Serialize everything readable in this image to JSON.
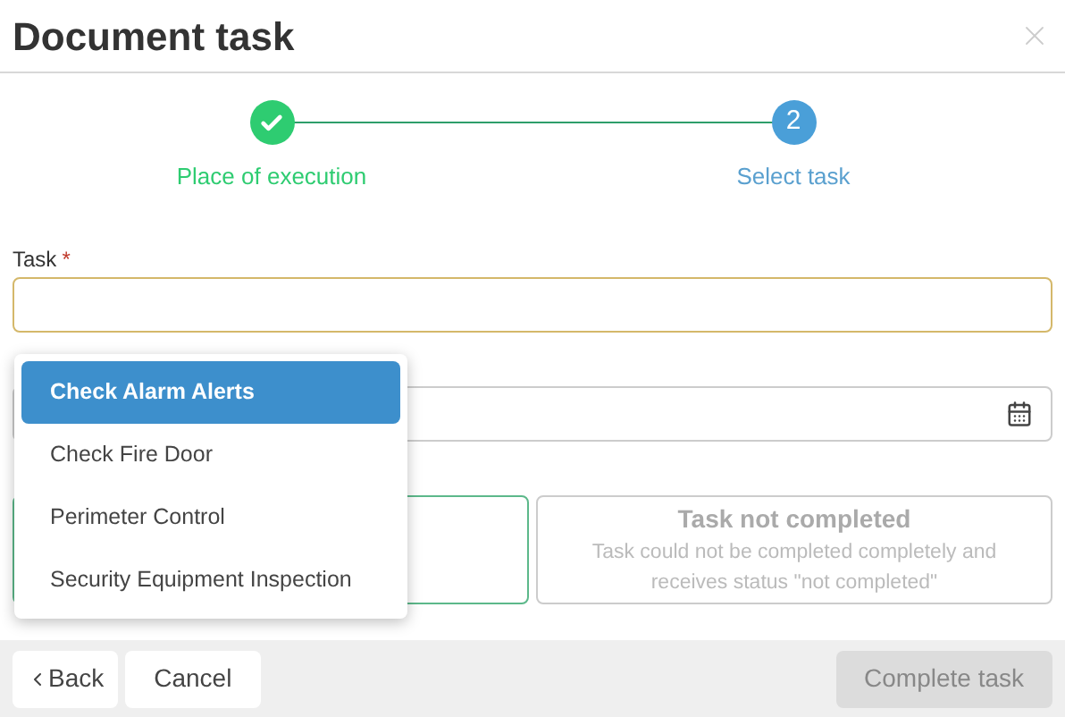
{
  "dialog": {
    "title": "Document task"
  },
  "steps": [
    {
      "label": "Place of execution",
      "kind": "done"
    },
    {
      "label": "Select task",
      "kind": "current",
      "number": "2"
    }
  ],
  "task_field": {
    "label": "Task",
    "required_mark": "*"
  },
  "dropdown": {
    "options": [
      {
        "label": "Check Alarm Alerts",
        "selected": true
      },
      {
        "label": "Check Fire Door",
        "selected": false
      },
      {
        "label": "Perimeter Control",
        "selected": false
      },
      {
        "label": "Security Equipment Inspection",
        "selected": false
      }
    ]
  },
  "outcomes": [
    {
      "selected": true
    },
    {
      "selected": false,
      "title": "Task not completed",
      "description": "Task could not be completed completely and receives status \"not completed\""
    }
  ],
  "footer": {
    "back": "Back",
    "cancel": "Cancel",
    "complete": {
      "label": "Complete task",
      "disabled": true
    }
  }
}
